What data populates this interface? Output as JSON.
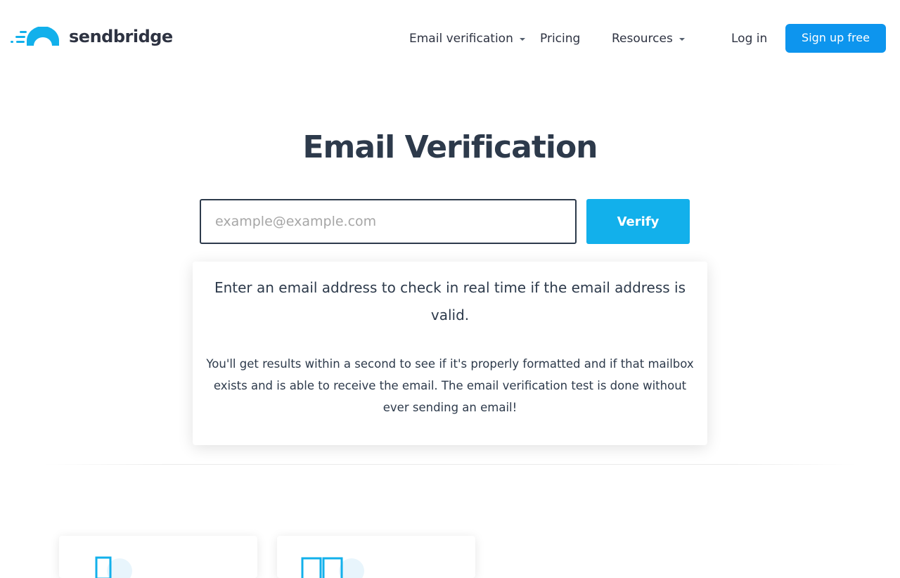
{
  "header": {
    "logo_text": "sendbridge",
    "nav": [
      {
        "label": "Email verification",
        "has_dropdown": true
      },
      {
        "label": "Pricing",
        "has_dropdown": false
      },
      {
        "label": "Resources",
        "has_dropdown": true
      }
    ],
    "login_label": "Log in",
    "signup_label": "Sign up free"
  },
  "main": {
    "title": "Email Verification",
    "email_input": {
      "value": "",
      "placeholder": "example@example.com"
    },
    "verify_label": "Verify",
    "info": {
      "lead": "Enter an email address to check in real time if the email address is valid.",
      "body": "You'll get results within a second to see if it's properly formatted and if that mailbox exists and is able to receive the email. The email verification test is done without ever sending an email!"
    }
  },
  "feature_cards": [
    {
      "icon": "document-icon"
    },
    {
      "icon": "grid-icon"
    }
  ],
  "colors": {
    "brand_blue": "#0d95ee",
    "verify_blue": "#12b0eb",
    "logo_cyan": "#12b0eb",
    "text_dark": "#2d3a4b"
  }
}
